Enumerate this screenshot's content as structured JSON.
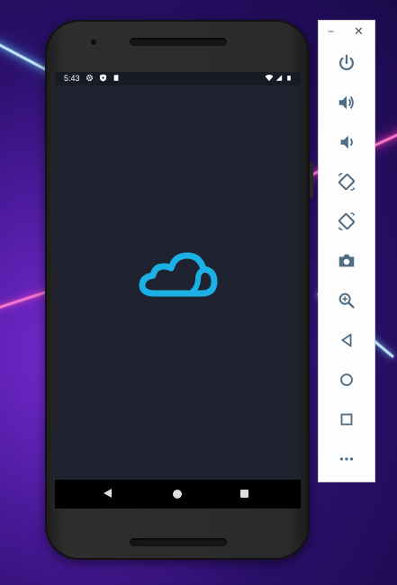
{
  "status_bar": {
    "time": "5:43"
  },
  "emulator_toolbar": {
    "minimize_glyph": "−",
    "close_glyph": "✕",
    "buttons": [
      {
        "icon": "power-icon"
      },
      {
        "icon": "volume-up-icon"
      },
      {
        "icon": "volume-down-icon"
      },
      {
        "icon": "rotate-left-icon"
      },
      {
        "icon": "rotate-right-icon"
      },
      {
        "icon": "camera-icon"
      },
      {
        "icon": "zoom-icon"
      },
      {
        "icon": "back-icon"
      },
      {
        "icon": "home-icon"
      },
      {
        "icon": "overview-icon"
      },
      {
        "icon": "more-icon"
      }
    ],
    "icon_color": "#4e6d84"
  },
  "app": {
    "logo": "cloud-logo",
    "accent": "#1bb1e6",
    "background": "#1f2330"
  },
  "nav_bar": {
    "back": "back-button",
    "home": "home-button",
    "recents": "recents-button"
  }
}
